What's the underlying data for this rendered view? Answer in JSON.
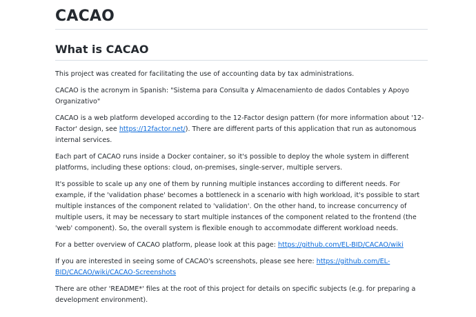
{
  "title": "CACAO",
  "section": {
    "heading": "What is CACAO"
  },
  "paragraphs": {
    "p1": "This project was created for facilitating the use of accounting data by tax administrations.",
    "p2": "CACAO is the acronym in Spanish: \"Sistema para Consulta y Almacenamiento de dados Contables y Apoyo Organizativo\"",
    "p3_before": "CACAO is a web platform developed according to the 12-Factor design pattern (for more information about '12-Factor' design, see ",
    "p3_link": "https://12factor.net/",
    "p3_after": "). There are different parts of this application that run as autonomous internal services.",
    "p4": "Each part of CACAO runs inside a Docker container, so it's possible to deploy the whole system in different platforms, including these options: cloud, on-premises, single-server, multiple servers.",
    "p5": "It's possible to scale up any one of them by running multiple instances according to different needs. For example, if the 'validation phase' becomes a bottleneck in a scenario with high workload, it's possible to start multiple instances of the component related to 'validation'. On the other hand, to increase concurrency of multiple users, it may be necessary to start multiple instances of the component related to the frontend (the 'web' component). So, the overall system is flexible enough to accommodate different workload needs.",
    "p6_before": "For a better overview of CACAO platform, please look at this page: ",
    "p6_link": "https://github.com/EL-BID/CACAO/wiki",
    "p7_before": "If you are interested in seeing some of CACAO's screenshots, please see here: ",
    "p7_link": "https://github.com/EL-BID/CACAO/wiki/CACAO-Screenshots",
    "p8": "There are other 'README*' files at the root of this project for details on specific subjects (e.g. for preparing a development environment)."
  },
  "colors": {
    "text": "#24292f",
    "link": "#0969da",
    "rule": "#d8dee4"
  }
}
